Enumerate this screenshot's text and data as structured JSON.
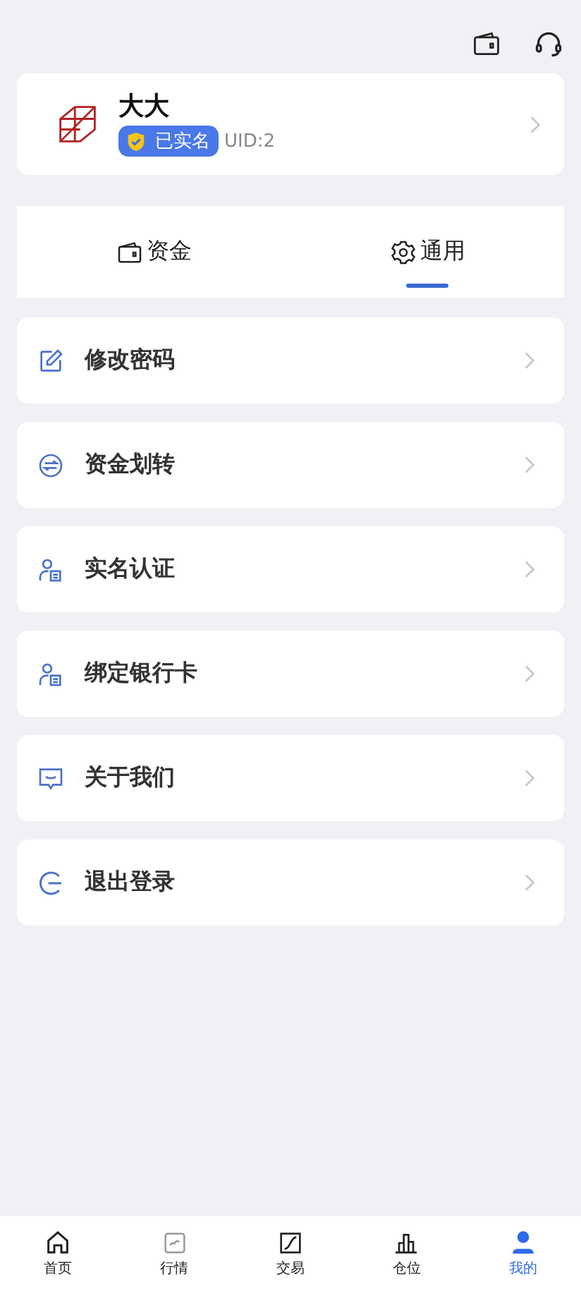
{
  "profile": {
    "name": "大大",
    "verified_label": "已实名",
    "uid": "UID:2"
  },
  "tabs": [
    {
      "label": "资金",
      "kind": "wallet",
      "selected": false
    },
    {
      "label": "通用",
      "kind": "gear",
      "selected": true
    }
  ],
  "menu": [
    {
      "label": "修改密码",
      "kind": "edit"
    },
    {
      "label": "资金划转",
      "kind": "transfer"
    },
    {
      "label": "实名认证",
      "kind": "identity"
    },
    {
      "label": "绑定银行卡",
      "kind": "identity"
    },
    {
      "label": "关于我们",
      "kind": "chat"
    },
    {
      "label": "退出登录",
      "kind": "logout"
    }
  ],
  "bottom_nav": [
    {
      "label": "首页",
      "kind": "home",
      "selected": false
    },
    {
      "label": "行情",
      "kind": "chart",
      "selected": false
    },
    {
      "label": "交易",
      "kind": "trade",
      "selected": false
    },
    {
      "label": "仓位",
      "kind": "bars",
      "selected": false
    },
    {
      "label": "我的",
      "kind": "user",
      "selected": true
    }
  ]
}
